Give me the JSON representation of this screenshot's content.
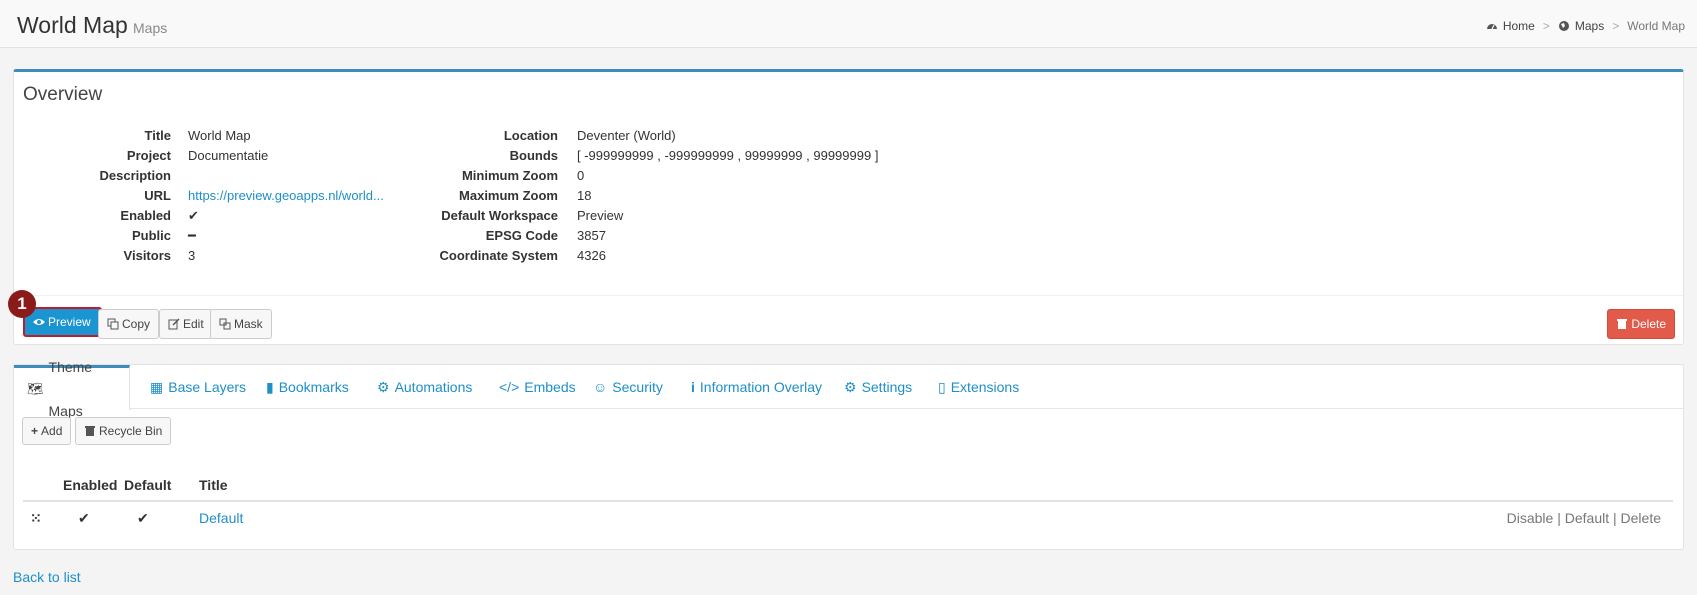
{
  "header": {
    "title": "World Map",
    "subtitle": "Maps",
    "breadcrumb": [
      "Home",
      "Maps",
      "World Map"
    ]
  },
  "overview": {
    "title": "Overview",
    "left": [
      {
        "key": "Title",
        "value": "World Map"
      },
      {
        "key": "Project",
        "value": "Documentatie"
      },
      {
        "key": "Description",
        "value": ""
      },
      {
        "key": "URL",
        "value": "https://preview.geoapps.nl/world..."
      },
      {
        "key": "Enabled",
        "value": "✔"
      },
      {
        "key": "Public",
        "value": "━"
      },
      {
        "key": "Visitors",
        "value": "3"
      }
    ],
    "right": [
      {
        "key": "Location",
        "value": "Deventer (World)"
      },
      {
        "key": "Bounds",
        "value": "[ -999999999 , -999999999 , 99999999 , 99999999 ]"
      },
      {
        "key": "Minimum Zoom",
        "value": "0"
      },
      {
        "key": "Maximum Zoom",
        "value": "18"
      },
      {
        "key": "Default Workspace",
        "value": "Preview"
      },
      {
        "key": "EPSG Code",
        "value": "3857"
      },
      {
        "key": "Coordinate System",
        "value": "4326"
      }
    ],
    "buttons": {
      "preview": "Preview",
      "copy": "Copy",
      "edit": "Edit",
      "mask": "Mask",
      "delete": "Delete"
    },
    "marker": "1"
  },
  "tabs": [
    {
      "label": "Theme Maps",
      "icon": "map-icon"
    },
    {
      "label": "Base Layers",
      "icon": "map-fill-icon"
    },
    {
      "label": "Bookmarks",
      "icon": "bookmark-icon"
    },
    {
      "label": "Automations",
      "icon": "cogs-icon"
    },
    {
      "label": "Embeds",
      "icon": "code-icon"
    },
    {
      "label": "Security",
      "icon": "users-icon"
    },
    {
      "label": "Information Overlay",
      "icon": "info-icon"
    },
    {
      "label": "Settings",
      "icon": "gear-icon"
    },
    {
      "label": "Extensions",
      "icon": "book-icon"
    }
  ],
  "theme_maps": {
    "add_label": "Add",
    "recycle_label": "Recycle Bin",
    "columns": [
      "Enabled",
      "Default",
      "Title"
    ],
    "rows": [
      {
        "enabled": "✔",
        "default": "✔",
        "title": "Default",
        "actions": "Disable | Default | Delete"
      }
    ]
  },
  "back_link": "Back to list",
  "colors": {
    "accent": "#3c8dbc",
    "link": "#1e8fc9",
    "preview": "#1b95d1",
    "delete": "#e25a4a",
    "marker": "#8b1a1a"
  }
}
